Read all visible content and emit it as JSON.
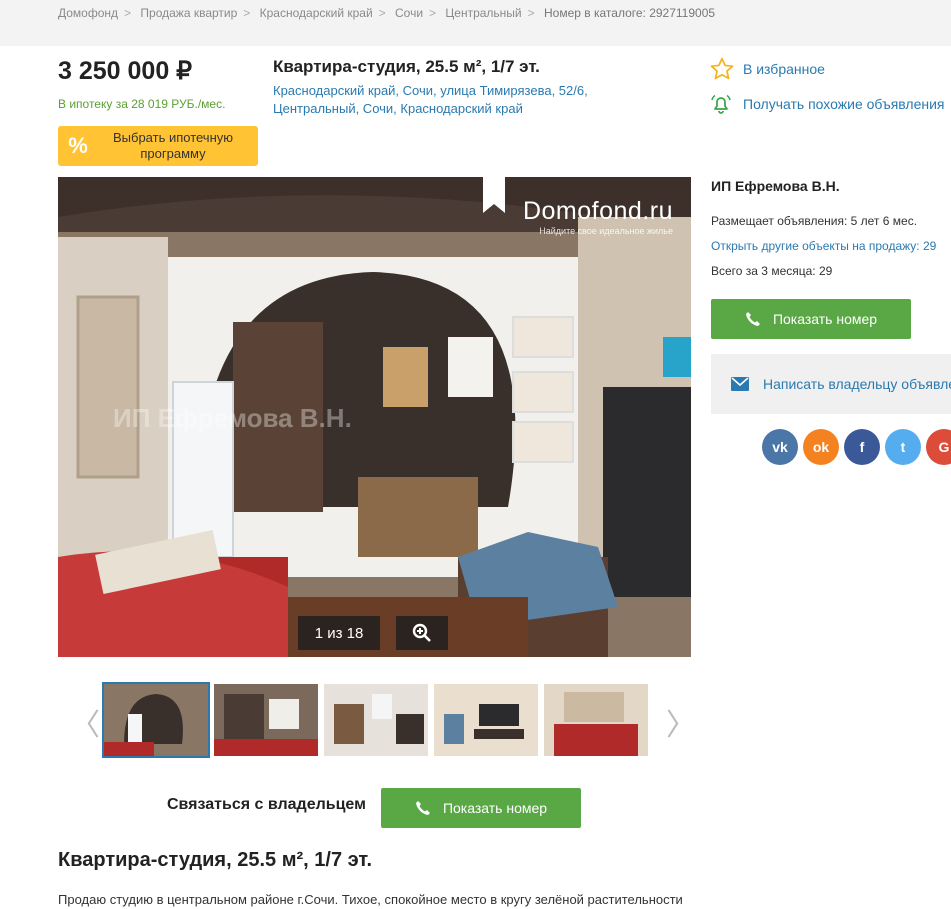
{
  "breadcrumbs": [
    "Домофонд",
    "Продажа квартир",
    "Краснодарский край",
    "Сочи",
    "Центральный"
  ],
  "catalog_number": "Номер в каталоге: 2927119005",
  "price": "3 250 000 ₽",
  "mortgage_text": "В ипотеку за 28 019 РУБ./мес.",
  "mortgage_button": {
    "icon": "%",
    "label": "Выбрать ипотечную программу"
  },
  "listing_title": "Квартира-студия, 25.5 м², 1/7 эт.",
  "address": "Краснодарский край, Сочи, улица Тимирязева, 52/6, Центральный, Сочи, Краснодарский край",
  "favorites_label": "В избранное",
  "subscribe_label": "Получать похожие объявления",
  "photo": {
    "logo": "Domofond.ru",
    "slogan": "Найдите свое идеальное жилье",
    "watermark": "ИП Ефремова В.Н.",
    "counter": "1 из 18"
  },
  "thumbnails": 5,
  "contact_label": "Связаться с владельцем",
  "show_number_label": "Показать номер",
  "seller": {
    "name": "ИП Ефремова В.Н.",
    "on_site": "Размещает объявления: 5 лет 6 мес.",
    "other_link": "Открыть другие объекты на продажу: 29",
    "total": "Всего за 3 месяца: 29"
  },
  "write_owner_label": "Написать владельцу объявления",
  "social": [
    {
      "name": "vk",
      "text": "vk",
      "color": "#4a76a8"
    },
    {
      "name": "ok",
      "text": "ok",
      "color": "#f58220"
    },
    {
      "name": "facebook",
      "text": "f",
      "color": "#3b5998"
    },
    {
      "name": "twitter",
      "text": "t",
      "color": "#55acee"
    },
    {
      "name": "google",
      "text": "G",
      "color": "#dd4b39"
    }
  ],
  "heading": "Квартира-студия, 25.5 м², 1/7 эт.",
  "description": "Продаю студию в центральном районе г.Сочи. Тихое, спокойное место в кругу зелёной растительности"
}
